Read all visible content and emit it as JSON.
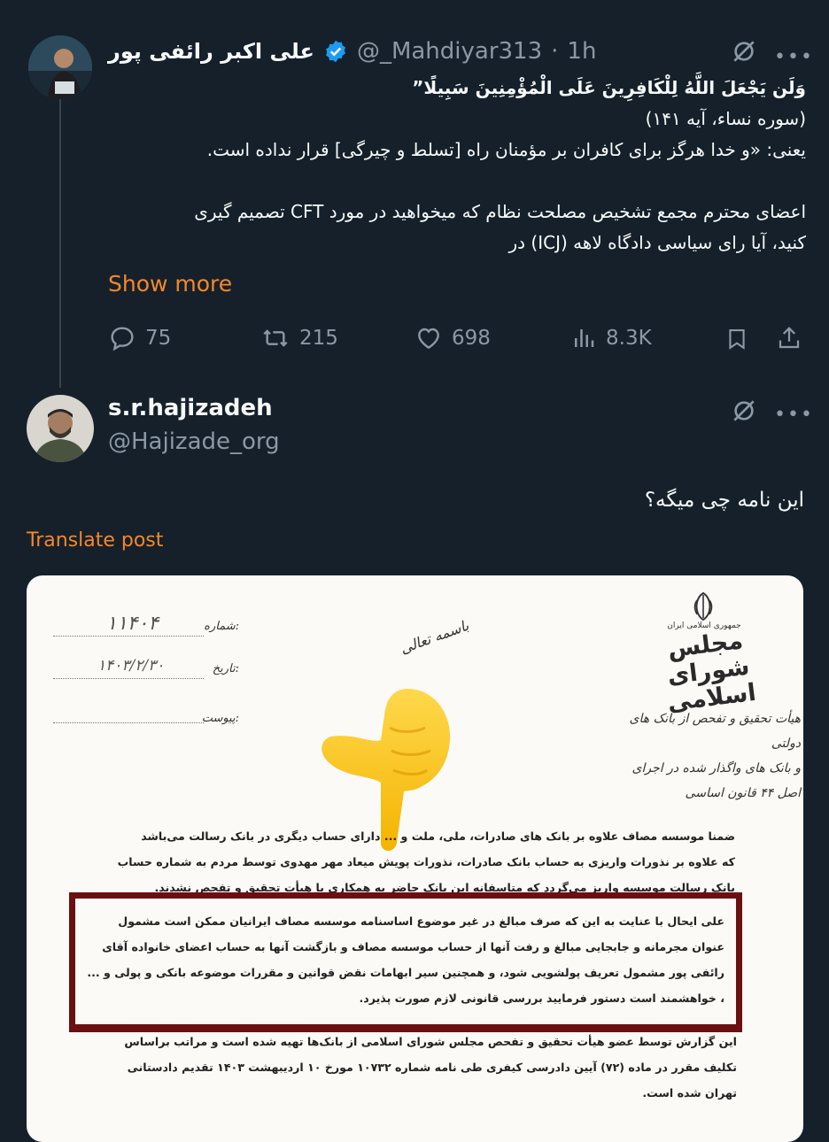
{
  "post1": {
    "author_name": "علی اکبر رائفی پور",
    "handle": "@_Mahdiyar313",
    "separator": "·",
    "time": "1h",
    "lines": [
      "وَلَن يَجْعَلَ اللَّهُ لِلْكَافِرِينَ عَلَى الْمُؤْمِنِينَ سَبِيلًا”",
      "(سوره نساء، آیه ۱۴۱)",
      "یعنی: «و خدا هرگز برای کافران بر مؤمنان راه [تسلط و چیرگی] قرار نداده است.",
      "اعضای محترم مجمع تشخیص  مصلحت نظام که میخواهید در مورد CFT تصمیم گیری",
      "کنید، آیا رای سیاسی دادگاه لاهه (ICJ) در"
    ],
    "show_more": "Show more",
    "actions": {
      "replies": "75",
      "reposts": "215",
      "likes": "698",
      "views": "8.3K"
    }
  },
  "post2": {
    "author_name": "s.r.hajizadeh",
    "handle": "@Hajizade_org",
    "text": "این نامه چی میگه؟",
    "translate": "Translate post"
  },
  "document": {
    "number_label": "شماره:",
    "number_value": "۱۱۴۰۴",
    "date_label": "تاریخ:",
    "date_value": "۱۴۰۳/۲/۳۰",
    "attachment_label": "پیوست:",
    "basmala": "باسمه تعالی",
    "emblem_text": "جمهوری اسلامی ایران",
    "parliament": "مجلس شورای اسلامی",
    "committee": [
      "هیأت تحقیق و تفحص از بانک های دولتی",
      "و بانک های واگذار شده در اجرای",
      "اصل ۴۴ قانون اساسی"
    ],
    "paragraph1": [
      "ضمنا موسسه مصاف علاوه بر بانک های صادرات، ملی، ملت و ... دارای حساب دیگری در بانک رسالت می‌باشد",
      "که علاوه بر نذورات واریزی به حساب بانک صادرات، نذورات پویش میعاد مهر مهدوی توسط مردم به شماره حساب",
      "بانک رسالت موسسه واریز می‌گردد که متاسفانه این بانک حاضر به همکاری با هیأت تحقیق و تفحص نشدند."
    ],
    "paragraph2": [
      "علی ایحال با عنایت به این که صرف مبالغ در غیر موضوع اساسنامه موسسه مصاف ایرانیان ممکن است مشمول",
      "عنوان مجرمانه و جابجایی مبالغ و رفت آنها از حساب موسسه مصاف و بازگشت آنها به حساب اعضای خانواده آقای",
      "رائفی پور مشمول تعریف پولشویی شود، و همچنین سیر ابهامات نقض قوانین و مقررات موضوعه بانکی و پولی و ...",
      "، خواهشمند است دستور فرمایید بررسی قانونی لازم صورت پذیرد."
    ],
    "paragraph3": [
      "این گزارش توسط عضو هیأت تحقیق و تفحص مجلس شورای اسلامی از بانک‌ها تهیه شده است و مراتب براساس",
      "تکلیف مقرر در ماده (۷۲) آیین دادرسی کیفری طی نامه شماره ۱۰۷۳۲ مورخ ۱۰ اردیبهشت ۱۴۰۳ تقدیم دادستانی",
      "تهران شده است."
    ],
    "highlight_color": "#6b0f12",
    "pointer_emoji": "👇"
  }
}
